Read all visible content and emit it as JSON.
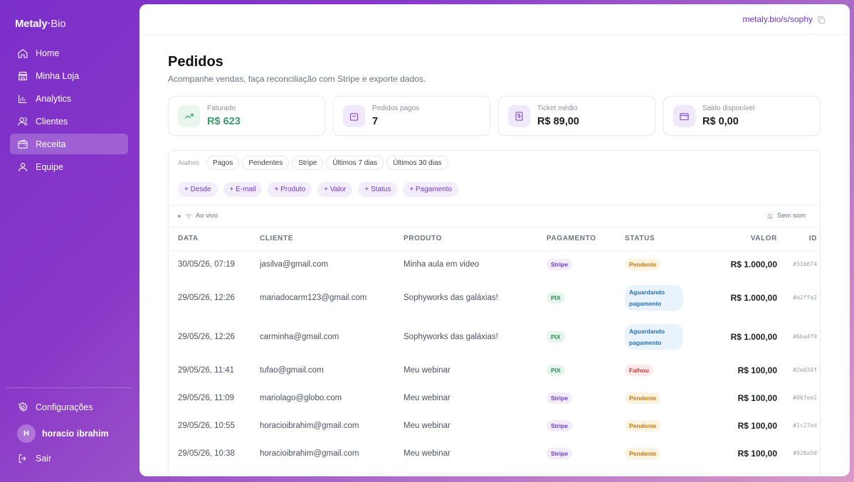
{
  "brand": {
    "name": "Metaly",
    "dot": "·",
    "suffix": "Bio"
  },
  "sidebar": {
    "items": [
      {
        "label": "Home",
        "icon": "home-icon"
      },
      {
        "label": "Minha Loja",
        "icon": "store-icon"
      },
      {
        "label": "Analytics",
        "icon": "bar-chart-icon"
      },
      {
        "label": "Clientes",
        "icon": "users-icon"
      },
      {
        "label": "Receita",
        "icon": "wallet-icon",
        "active": true
      },
      {
        "label": "Equipe",
        "icon": "team-icon"
      }
    ],
    "settings_label": "Configurações",
    "user": {
      "initial": "H",
      "name": "horacio ibrahim"
    },
    "logout_label": "Sair"
  },
  "topbar": {
    "site_link": "metaly.bio/s/sophy"
  },
  "page": {
    "title": "Pedidos",
    "subtitle": "Acompanhe vendas, faça reconciliação com Stripe e exporte dados."
  },
  "stats": [
    {
      "label": "Faturado",
      "value": "R$ 623",
      "icon": "trending-up-icon"
    },
    {
      "label": "Pedidos pagos",
      "value": "7",
      "icon": "shopping-bag-icon"
    },
    {
      "label": "Ticket médio",
      "value": "R$ 89,00",
      "icon": "receipt-icon"
    },
    {
      "label": "Saldo disponível",
      "value": "R$ 0,00",
      "icon": "wallet-icon"
    }
  ],
  "shortcuts": {
    "label": "Atalhos",
    "items": [
      "Pagos",
      "Pendentes",
      "Stripe",
      "Últimos 7 dias",
      "Últimos 30 dias"
    ]
  },
  "filters": [
    "+ Desde",
    "+ E-mail",
    "+ Produto",
    "+ Valor",
    "+ Status",
    "+ Pagamento"
  ],
  "live": {
    "label": "Ao vivo",
    "mute_label": "Sem som"
  },
  "table": {
    "headers": {
      "data": "DATA",
      "cliente": "CLIENTE",
      "produto": "PRODUTO",
      "pagamento": "PAGAMENTO",
      "status": "STATUS",
      "valor": "VALOR",
      "id": "ID"
    },
    "rows": [
      {
        "data": "30/05/26, 07:19",
        "cliente": "jasilva@gmail.com",
        "produto": "Minha aula em video",
        "pagamento": "Stripe",
        "status": "Pendente",
        "valor": "R$ 1.000,00",
        "id": "#31b674"
      },
      {
        "data": "29/05/26, 12:26",
        "cliente": "mariadocarm123@gmail.com",
        "produto": "Sophyworks das galáxias!",
        "pagamento": "PIX",
        "status": "Aguardando pagamento",
        "valor": "R$ 1.000,00",
        "id": "#a2ffa2"
      },
      {
        "data": "29/05/26, 12:26",
        "cliente": "carminha@gmail.com",
        "produto": "Sophyworks das galáxias!",
        "pagamento": "PIX",
        "status": "Aguardando pagamento",
        "valor": "R$ 1.000,00",
        "id": "#6ba4f9"
      },
      {
        "data": "29/05/26, 11:41",
        "cliente": "tufao@gmail.com",
        "produto": "Meu webinar",
        "pagamento": "PIX",
        "status": "Falhou",
        "valor": "R$ 100,00",
        "id": "#2e834f"
      },
      {
        "data": "29/05/26, 11:09",
        "cliente": "mariolago@globo.com",
        "produto": "Meu webinar",
        "pagamento": "Stripe",
        "status": "Pendente",
        "valor": "R$ 100,00",
        "id": "#06fee2"
      },
      {
        "data": "29/05/26, 10:55",
        "cliente": "horacioibrahim@gmail.com",
        "produto": "Meu webinar",
        "pagamento": "Stripe",
        "status": "Pendente",
        "valor": "R$ 100,00",
        "id": "#1c27ed"
      },
      {
        "data": "29/05/26, 10:38",
        "cliente": "horacioibrahim@gmail.com",
        "produto": "Meu webinar",
        "pagamento": "Stripe",
        "status": "Pendente",
        "valor": "R$ 100,00",
        "id": "#928a50"
      }
    ]
  },
  "colors": {
    "accent": "#6d35c9",
    "sidebar_gradient_start": "#7b2fc9",
    "sidebar_gradient_end": "#d99ac8",
    "positive": "#3a9a68"
  }
}
